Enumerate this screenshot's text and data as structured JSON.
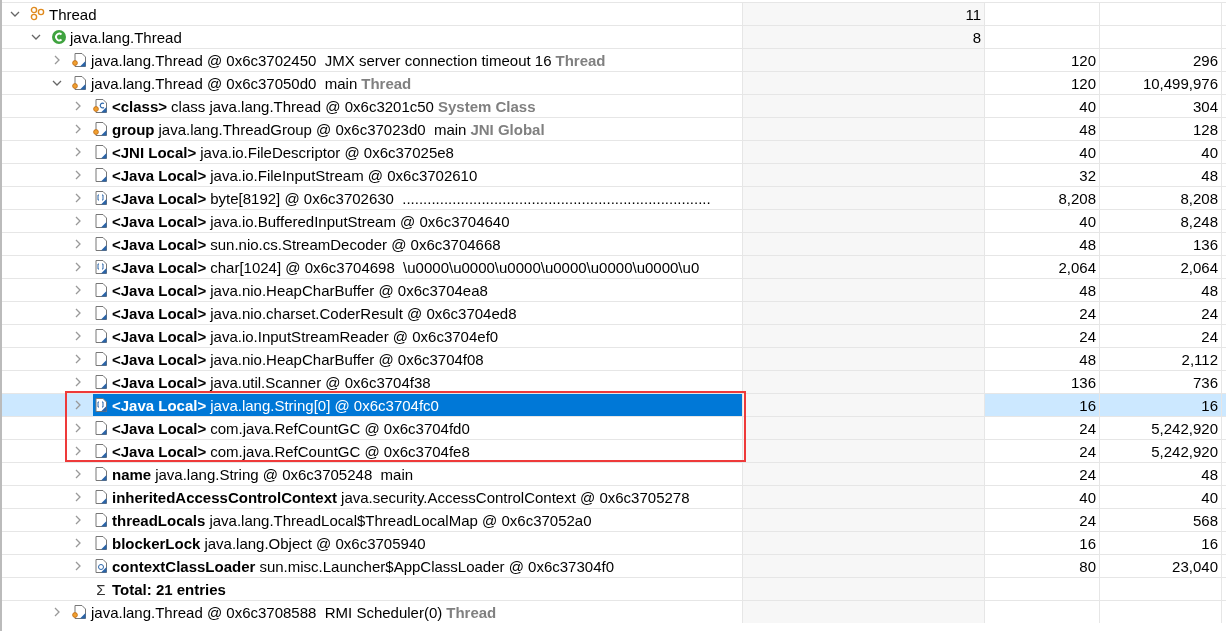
{
  "rows": [
    {
      "kind": "group",
      "expanded": true,
      "selected": false,
      "boxed": false,
      "text": "Thread",
      "objects": "11",
      "children": [
        {
          "kind": "class",
          "expanded": true,
          "selected": false,
          "boxed": false,
          "text": "java.lang.Thread",
          "objects": "8",
          "children": [
            {
              "kind": "thread",
              "expanded": false,
              "selected": false,
              "boxed": false,
              "text": "java.lang.Thread @ 0x6c3702450  JMX server connection timeout 16",
              "tag": "Thread",
              "shallow": "120",
              "retained": "296"
            },
            {
              "kind": "thread",
              "expanded": true,
              "selected": false,
              "boxed": false,
              "text": "java.lang.Thread @ 0x6c37050d0  main",
              "tag": "Thread",
              "shallow": "120",
              "retained": "10,499,976",
              "children": [
                {
                  "kind": "class-object",
                  "expanded": false,
                  "selected": false,
                  "boxed": false,
                  "field": "<class>",
                  "text": "class java.lang.Thread @ 0x6c3201c50",
                  "tag": "System Class",
                  "shallow": "40",
                  "retained": "304"
                },
                {
                  "kind": "thread",
                  "expanded": false,
                  "selected": false,
                  "boxed": false,
                  "field": "group",
                  "text": "java.lang.ThreadGroup @ 0x6c37023d0  main",
                  "tag": "JNI Global",
                  "shallow": "48",
                  "retained": "128"
                },
                {
                  "kind": "object",
                  "expanded": false,
                  "selected": false,
                  "boxed": false,
                  "field": "<JNI Local>",
                  "text": "java.io.FileDescriptor @ 0x6c37025e8",
                  "shallow": "40",
                  "retained": "40"
                },
                {
                  "kind": "object",
                  "expanded": false,
                  "selected": false,
                  "boxed": false,
                  "field": "<Java Local>",
                  "text": "java.io.FileInputStream @ 0x6c3702610",
                  "shallow": "32",
                  "retained": "48"
                },
                {
                  "kind": "array",
                  "expanded": false,
                  "selected": false,
                  "boxed": false,
                  "field": "<Java Local>",
                  "text": "byte[8192] @ 0x6c3702630  ..........................................................................",
                  "shallow": "8,208",
                  "retained": "8,208"
                },
                {
                  "kind": "object",
                  "expanded": false,
                  "selected": false,
                  "boxed": false,
                  "field": "<Java Local>",
                  "text": "java.io.BufferedInputStream @ 0x6c3704640",
                  "shallow": "40",
                  "retained": "8,248"
                },
                {
                  "kind": "object",
                  "expanded": false,
                  "selected": false,
                  "boxed": false,
                  "field": "<Java Local>",
                  "text": "sun.nio.cs.StreamDecoder @ 0x6c3704668",
                  "shallow": "48",
                  "retained": "136"
                },
                {
                  "kind": "array",
                  "expanded": false,
                  "selected": false,
                  "boxed": false,
                  "field": "<Java Local>",
                  "text": "char[1024] @ 0x6c3704698  \\u0000\\u0000\\u0000\\u0000\\u0000\\u0000\\u0",
                  "shallow": "2,064",
                  "retained": "2,064"
                },
                {
                  "kind": "object",
                  "expanded": false,
                  "selected": false,
                  "boxed": false,
                  "field": "<Java Local>",
                  "text": "java.nio.HeapCharBuffer @ 0x6c3704ea8",
                  "shallow": "48",
                  "retained": "48"
                },
                {
                  "kind": "object",
                  "expanded": false,
                  "selected": false,
                  "boxed": false,
                  "field": "<Java Local>",
                  "text": "java.nio.charset.CoderResult @ 0x6c3704ed8",
                  "shallow": "24",
                  "retained": "24"
                },
                {
                  "kind": "object",
                  "expanded": false,
                  "selected": false,
                  "boxed": false,
                  "field": "<Java Local>",
                  "text": "java.io.InputStreamReader @ 0x6c3704ef0",
                  "shallow": "24",
                  "retained": "24"
                },
                {
                  "kind": "object",
                  "expanded": false,
                  "selected": false,
                  "boxed": false,
                  "field": "<Java Local>",
                  "text": "java.nio.HeapCharBuffer @ 0x6c3704f08",
                  "shallow": "48",
                  "retained": "2,112"
                },
                {
                  "kind": "object",
                  "expanded": false,
                  "selected": false,
                  "boxed": false,
                  "field": "<Java Local>",
                  "text": "java.util.Scanner @ 0x6c3704f38",
                  "shallow": "136",
                  "retained": "736"
                },
                {
                  "kind": "array",
                  "expanded": false,
                  "selected": true,
                  "boxed": true,
                  "field": "<Java Local>",
                  "text": "java.lang.String[0] @ 0x6c3704fc0",
                  "shallow": "16",
                  "retained": "16"
                },
                {
                  "kind": "object",
                  "expanded": false,
                  "selected": false,
                  "boxed": true,
                  "field": "<Java Local>",
                  "text": "com.java.RefCountGC @ 0x6c3704fd0",
                  "shallow": "24",
                  "retained": "5,242,920"
                },
                {
                  "kind": "object",
                  "expanded": false,
                  "selected": false,
                  "boxed": true,
                  "field": "<Java Local>",
                  "text": "com.java.RefCountGC @ 0x6c3704fe8",
                  "shallow": "24",
                  "retained": "5,242,920"
                },
                {
                  "kind": "object",
                  "expanded": false,
                  "selected": false,
                  "boxed": false,
                  "field": "name",
                  "text": "java.lang.String @ 0x6c3705248  main",
                  "shallow": "24",
                  "retained": "48"
                },
                {
                  "kind": "object",
                  "expanded": false,
                  "selected": false,
                  "boxed": false,
                  "field": "inheritedAccessControlContext",
                  "text": "java.security.AccessControlContext @ 0x6c3705278",
                  "shallow": "40",
                  "retained": "40"
                },
                {
                  "kind": "object",
                  "expanded": false,
                  "selected": false,
                  "boxed": false,
                  "field": "threadLocals",
                  "text": "java.lang.ThreadLocal$ThreadLocalMap @ 0x6c37052a0",
                  "shallow": "24",
                  "retained": "568"
                },
                {
                  "kind": "object",
                  "expanded": false,
                  "selected": false,
                  "boxed": false,
                  "field": "blockerLock",
                  "text": "java.lang.Object @ 0x6c3705940",
                  "shallow": "16",
                  "retained": "16"
                },
                {
                  "kind": "classloader",
                  "expanded": false,
                  "selected": false,
                  "boxed": false,
                  "field": "contextClassLoader",
                  "text": "sun.misc.Launcher$AppClassLoader @ 0x6c37304f0",
                  "shallow": "80",
                  "retained": "23,040"
                },
                {
                  "kind": "total",
                  "selected": false,
                  "boxed": false,
                  "symbol": "Σ",
                  "field": "Total: 21 entries"
                }
              ]
            },
            {
              "kind": "thread",
              "expanded": false,
              "selected": false,
              "boxed": false,
              "text": "java.lang.Thread @ 0x6c3708588  RMI Scheduler(0)",
              "tag": "Thread"
            }
          ]
        }
      ]
    }
  ]
}
